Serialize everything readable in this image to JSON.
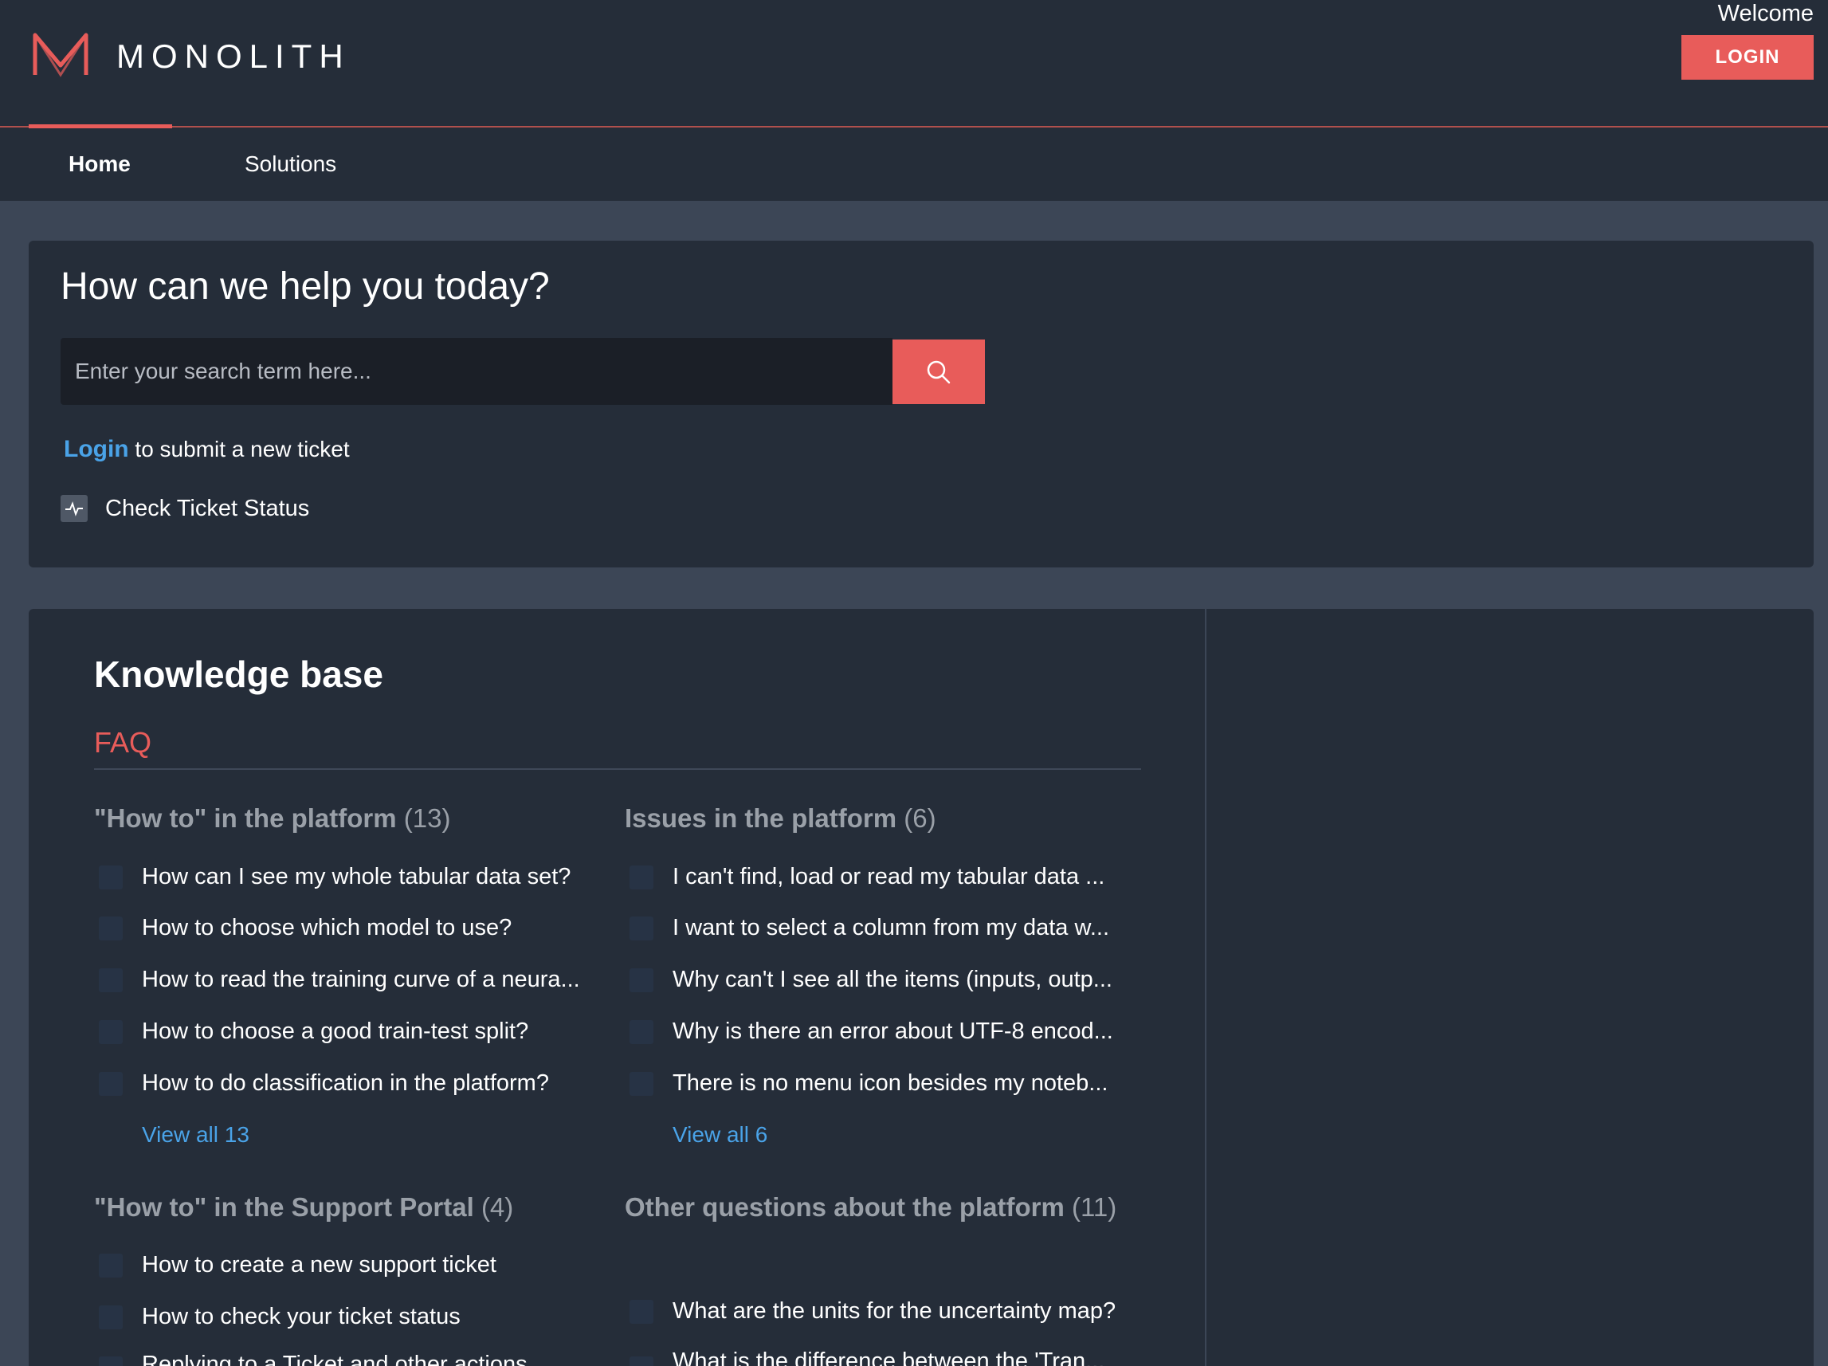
{
  "header": {
    "brand": "MONOLITH",
    "welcome": "Welcome",
    "login_label": "LOGIN",
    "accent_color": "#e85c5a",
    "logo_icon": "monolith-m-logo"
  },
  "nav": {
    "tabs": [
      {
        "label": "Home",
        "active": true
      },
      {
        "label": "Solutions",
        "active": false
      }
    ]
  },
  "help": {
    "title": "How can we help you today?",
    "search_placeholder": "Enter your search term here...",
    "search_icon": "search-icon",
    "login_link": "Login",
    "login_suffix": "to submit a new ticket",
    "check_status": "Check Ticket Status",
    "status_icon": "activity-icon"
  },
  "knowledge": {
    "title": "Knowledge base",
    "section": "FAQ",
    "categories": [
      {
        "title": "\"How to\" in the platform",
        "count": "(13)",
        "articles": [
          "How can I see my whole tabular data set?",
          "How to choose which model to use?",
          "How to read the training curve of a neura...",
          "How to choose a good train-test split?",
          "How to do classification in the platform?"
        ],
        "view_all": "View all 13"
      },
      {
        "title": "Issues in the platform",
        "count": "(6)",
        "articles": [
          "I can't find, load or read my tabular data ...",
          "I want to select a column from my data w...",
          "Why can't I see all the items (inputs, outp...",
          "Why is there an error about UTF-8 encod...",
          "There is no menu icon besides my noteb..."
        ],
        "view_all": "View all 6"
      },
      {
        "title": "\"How to\" in the Support Portal",
        "count": "(4)",
        "articles": [
          "How to create a new support ticket",
          "How to check your ticket status",
          "Replying to a Ticket and other actions"
        ]
      },
      {
        "title": "Other questions about the platform",
        "count": "(11)",
        "articles": [
          "What are the units for the uncertainty map?",
          "What is the difference between the 'Tran..."
        ]
      }
    ]
  }
}
